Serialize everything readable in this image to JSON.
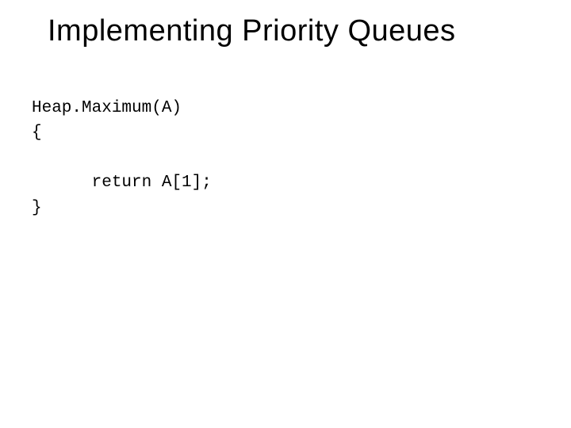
{
  "slide": {
    "title": "Implementing Priority Queues",
    "code": {
      "line1": "Heap.Maximum(A)",
      "line2": "{",
      "line3": "",
      "line4": "      return A[1];",
      "line5": "}"
    }
  }
}
